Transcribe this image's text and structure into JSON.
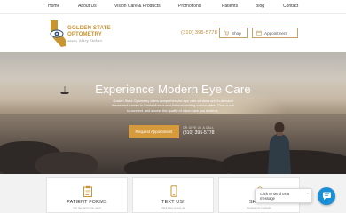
{
  "nav": {
    "items": [
      {
        "label": "Home"
      },
      {
        "label": "About Us"
      },
      {
        "label": "Vision Care & Products"
      },
      {
        "label": "Promotions"
      },
      {
        "label": "Patients"
      },
      {
        "label": "Blog"
      },
      {
        "label": "Contact"
      }
    ]
  },
  "header": {
    "logo_line1": "GOLDEN STATE",
    "logo_line2": "OPTOMETRY",
    "logo_byline": "owned by",
    "logo_signature": "Mary Zinkan",
    "phone": "(310) 395-5778",
    "shop_label": "Shop",
    "appointment_label": "Appointment"
  },
  "hero": {
    "title": "Experience Modern Eye Care",
    "description": "Golden State Optometry offers comprehensive eye care services and in-demand lenses and frames to Santa Monica and the surrounding communities. Click or call to connect, and access the quality of vision care you deserve.",
    "cta_label": "Request Appointment",
    "call_label": "OR GIVE US A CALL",
    "call_number": "(310) 395-5778"
  },
  "cards": [
    {
      "title": "PATIENT FORMS",
      "sub": "Get the forms you need",
      "icon": "clipboard-icon"
    },
    {
      "title": "TEXT US!",
      "sub": "Click here to text us",
      "icon": "mobile-phone-icon"
    },
    {
      "title": "SHOP O",
      "sub": "Browse our products",
      "icon": "shopping-bag-icon"
    }
  ],
  "chat": {
    "bubble_text_1": "Click to send us a",
    "bubble_text_2": "message",
    "close": "×"
  },
  "colors": {
    "accent_gold": "#d49a3b",
    "chat_blue": "#1b8fd6"
  }
}
